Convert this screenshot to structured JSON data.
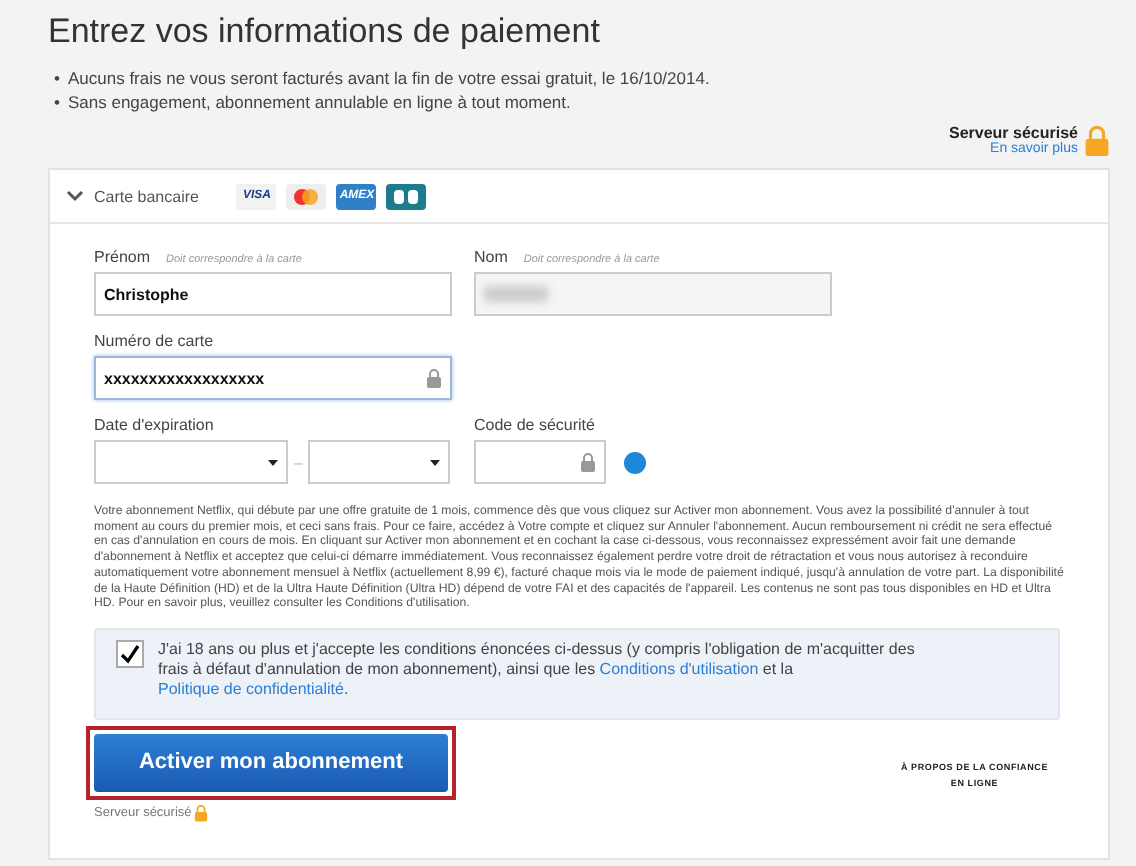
{
  "title": "Entrez vos informations de paiement",
  "bullet_marker": "•",
  "bullets": [
    "Aucuns frais ne vous seront facturés avant la fin de votre essai gratuit, le 16/10/2014.",
    "Sans engagement, abonnement annulable en ligne à tout moment."
  ],
  "secure_server": {
    "label": "Serveur sécurisé",
    "link": "En savoir plus"
  },
  "payment_method": {
    "label": "Carte bancaire",
    "expanded": true,
    "cards": [
      {
        "kind": "visa",
        "label": "VISA"
      },
      {
        "kind": "mastercard"
      },
      {
        "kind": "amex",
        "label": "AMEX"
      },
      {
        "kind": "cb"
      }
    ]
  },
  "fields": {
    "first_name": {
      "label": "Prénom",
      "hint": "Doit correspondre à la carte",
      "value": "Christophe"
    },
    "last_name": {
      "label": "Nom",
      "hint": "Doit correspondre à la carte",
      "blurred": true
    },
    "card_number": {
      "label": "Numéro de carte",
      "value": "xxxxxxxxxxxxxxxxxx",
      "focused": true
    },
    "expiration": {
      "label": "Date d'expiration",
      "separator": "–"
    },
    "security_code": {
      "label": "Code de sécurité"
    }
  },
  "legal_text": "Votre abonnement Netflix, qui débute par une offre gratuite de 1 mois, commence dès que vous cliquez sur Activer mon abonnement. Vous avez la possibilité d'annuler à tout moment au cours du premier mois, et ceci sans frais. Pour ce faire, accédez à Votre compte et cliquez sur Annuler l'abonnement. Aucun remboursement ni crédit ne sera effectué en cas d'annulation en cours de mois. En cliquant sur Activer mon abonnement et en cochant la case ci-dessous, vous reconnaissez expressément avoir fait une demande d'abonnement à Netflix et acceptez que celui-ci démarre immédiatement. Vous reconnaissez également perdre votre droit de rétractation et vous nous autorisez à reconduire automatiquement votre abonnement mensuel à Netflix (actuellement 8,99 €), facturé chaque mois via le mode de paiement indiqué, jusqu'à annulation de votre part. La disponibilité de la Haute Définition (HD) et de la Ultra Haute Définition (Ultra HD) dépend de votre FAI et des capacités de l'appareil. Les contenus ne sont pas tous disponibles en HD et Ultra HD. Pour en savoir plus, veuillez consulter les Conditions d'utilisation.",
  "agreement": {
    "checked": true,
    "text_before": "J'ai 18 ans ou plus et j'accepte les conditions énoncées ci-dessus (y compris l'obligation de m'acquitter des frais à défaut d'annulation de mon abonnement), ainsi que les",
    "link_terms": "Conditions d'utilisation",
    "text_middle": "et la",
    "link_privacy": "Politique de confidentialité",
    "text_after": "."
  },
  "submit_button": {
    "label": "Activer mon abonnement",
    "highlighted": true
  },
  "footer_secure": "Serveur sécurisé",
  "trust_link": [
    "À PROPOS DE LA CONFIANCE",
    "EN LIGNE"
  ]
}
